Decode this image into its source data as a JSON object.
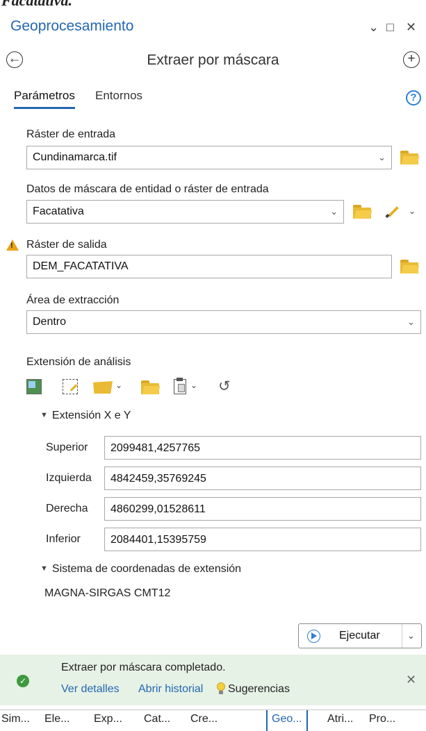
{
  "doc_strip": "Facatativa.",
  "pane": {
    "title": "Geoprocesamiento",
    "ctrl_dropdown": "⌄",
    "ctrl_maximize": "□",
    "ctrl_close": "✕"
  },
  "tool": {
    "back_glyph": "←",
    "title": "Extraer por máscara",
    "add_glyph": "+"
  },
  "tabs": {
    "parameters": "Parámetros",
    "environments": "Entornos",
    "help_glyph": "?"
  },
  "params": {
    "input_raster_label": "Ráster de entrada",
    "input_raster_value": "Cundinamarca.tif",
    "mask_label": "Datos de máscara de entidad o ráster de entrada",
    "mask_value": "Facatativa",
    "output_label": "Ráster de salida",
    "output_value": "DEM_FACATATIVA",
    "area_label": "Área de extracción",
    "area_value": "Dentro",
    "analysis_extent_label": "Extensión de análisis"
  },
  "extent": {
    "xy_toggle": "Extensión X e Y",
    "top_label": "Superior",
    "top_value": "2099481,4257765",
    "left_label": "Izquierda",
    "left_value": "4842459,35769245",
    "right_label": "Derecha",
    "right_value": "4860299,01528611",
    "bottom_label": "Inferior",
    "bottom_value": "2084401,15395759",
    "sr_toggle": "Sistema de coordenadas de extensión",
    "sr_value": "MAGNA-SIRGAS CMT12"
  },
  "run": {
    "label": "Ejecutar"
  },
  "status": {
    "message": "Extraer por máscara completado.",
    "details_link": "Ver detalles",
    "history_link": "Abrir historial",
    "tips_link": "Sugerencias",
    "close_glyph": "✕",
    "ok_glyph": "✓",
    "accent": "#3f9a3f"
  },
  "bottom_tabs": [
    "Sim...",
    "Ele...",
    "Exp...",
    "Cat...",
    "Cre...",
    "Geo...",
    "Atri...",
    "Pro..."
  ],
  "colors": {
    "accent_blue": "#2467b0",
    "folder_yellow": "#e9bb34",
    "warning": "#e8a317"
  },
  "icons": [
    "back-arrow-icon",
    "add-icon",
    "help-icon",
    "folder-icon",
    "pencil-icon",
    "warning-icon",
    "layer-extent-icon",
    "draw-extent-icon",
    "polygon-extent-icon",
    "browse-extent-icon",
    "paste-extent-icon",
    "reset-extent-icon",
    "play-icon",
    "checkmark-icon",
    "lightbulb-icon",
    "close-icon"
  ]
}
